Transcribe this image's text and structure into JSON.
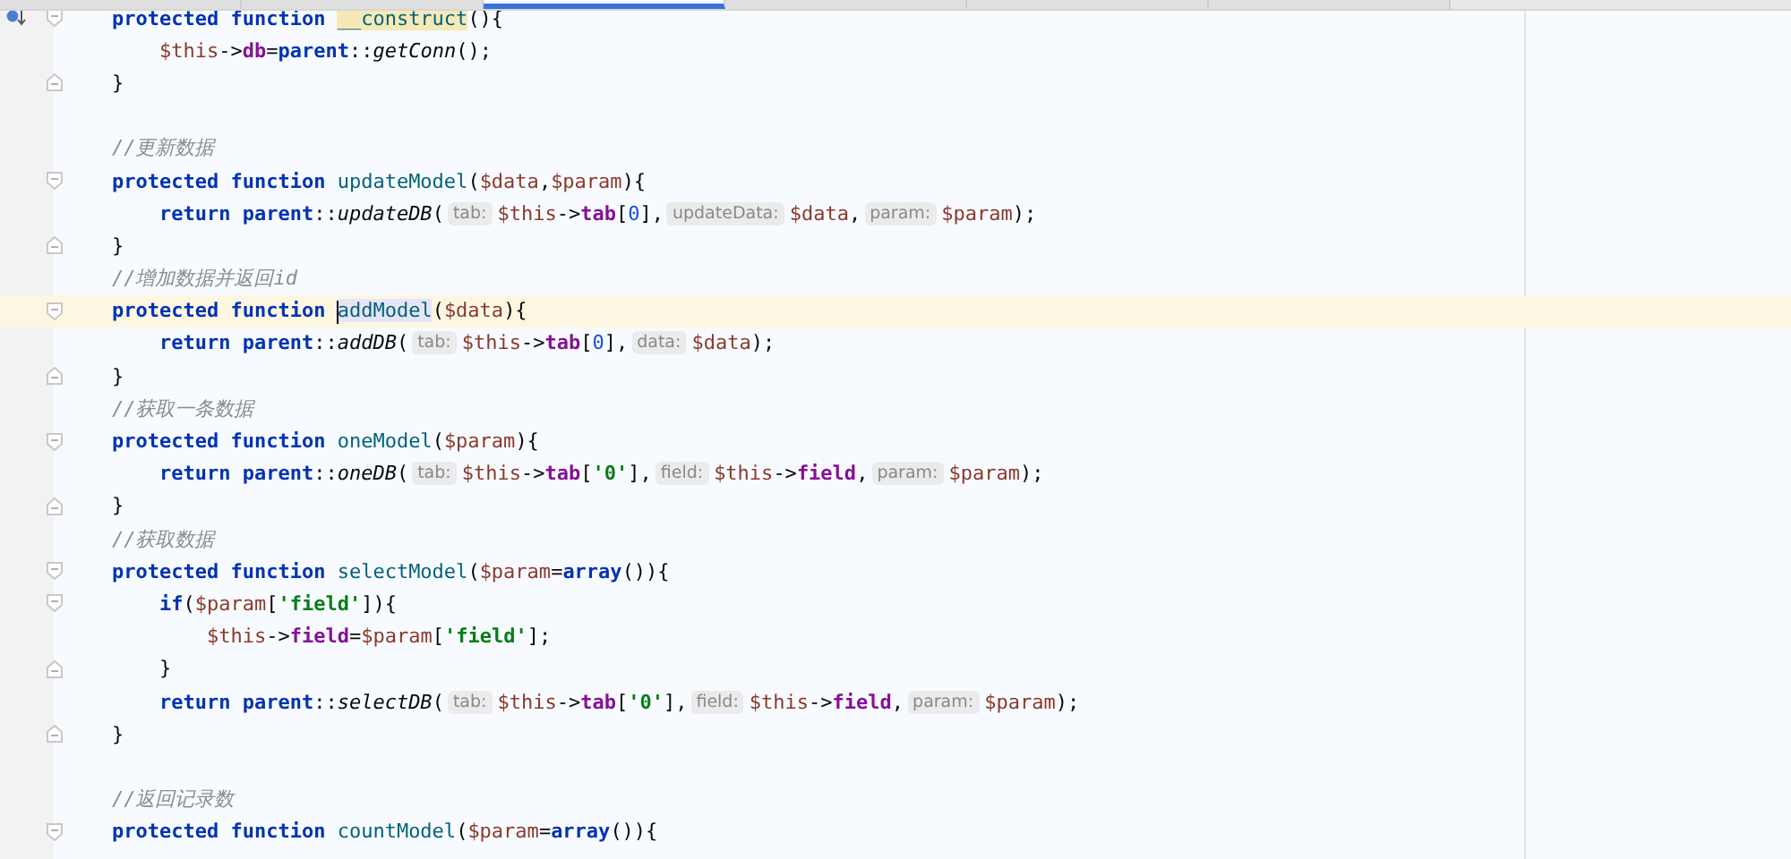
{
  "tabs": [
    {
      "selected": false
    },
    {
      "selected": false
    },
    {
      "selected": true
    },
    {
      "selected": false
    },
    {
      "selected": false
    },
    {
      "selected": false
    }
  ],
  "lines": [
    {
      "kind": "code",
      "fold_start": true,
      "gutter_mark": true,
      "segments": [
        {
          "kind": "code",
          "tokens": [
            {
              "kind": "kw",
              "s": "    protected function "
            },
            {
              "kind": "decl",
              "s": "__construct",
              "match_highlight": true
            },
            {
              "kind": "plain",
              "s": "(){"
            }
          ]
        }
      ]
    },
    {
      "kind": "code",
      "segments": [
        {
          "kind": "code",
          "tokens": [
            {
              "kind": "var",
              "s": "        $this"
            },
            {
              "kind": "plain",
              "s": "->"
            },
            {
              "kind": "prop",
              "s": "db"
            },
            {
              "kind": "plain",
              "s": "="
            },
            {
              "kind": "kw",
              "s": "parent"
            },
            {
              "kind": "plain",
              "s": "::"
            },
            {
              "kind": "call",
              "s": "getConn"
            },
            {
              "kind": "plain",
              "s": "();"
            }
          ]
        }
      ]
    },
    {
      "kind": "code",
      "fold_end": true,
      "segments": [
        {
          "kind": "code",
          "tokens": [
            {
              "kind": "plain",
              "s": "    }"
            }
          ]
        }
      ]
    },
    {
      "kind": "blank"
    },
    {
      "kind": "code",
      "segments": [
        {
          "kind": "code",
          "tokens": [
            {
              "kind": "comment",
              "s": "    //更新数据"
            }
          ]
        }
      ]
    },
    {
      "kind": "code",
      "fold_start": true,
      "segments": [
        {
          "kind": "code",
          "tokens": [
            {
              "kind": "kw",
              "s": "    protected function "
            },
            {
              "kind": "decl",
              "s": "updateModel"
            },
            {
              "kind": "plain",
              "s": "("
            },
            {
              "kind": "var",
              "s": "$data"
            },
            {
              "kind": "plain",
              "s": ","
            },
            {
              "kind": "var",
              "s": "$param"
            },
            {
              "kind": "plain",
              "s": "){"
            }
          ]
        }
      ]
    },
    {
      "kind": "code",
      "segments": [
        {
          "kind": "code",
          "tokens": [
            {
              "kind": "kw",
              "s": "        return parent"
            },
            {
              "kind": "plain",
              "s": "::"
            },
            {
              "kind": "call",
              "s": "updateDB"
            },
            {
              "kind": "plain",
              "s": "("
            }
          ]
        },
        {
          "kind": "hint",
          "text": "tab:"
        },
        {
          "kind": "code",
          "tokens": [
            {
              "kind": "var",
              "s": "$this"
            },
            {
              "kind": "plain",
              "s": "->"
            },
            {
              "kind": "prop",
              "s": "tab"
            },
            {
              "kind": "plain",
              "s": "["
            },
            {
              "kind": "num",
              "s": "0"
            },
            {
              "kind": "plain",
              "s": "],"
            }
          ]
        },
        {
          "kind": "hint",
          "text": "updateData:"
        },
        {
          "kind": "code",
          "tokens": [
            {
              "kind": "var",
              "s": "$data"
            },
            {
              "kind": "plain",
              "s": ","
            }
          ]
        },
        {
          "kind": "hint",
          "text": "param:"
        },
        {
          "kind": "code",
          "tokens": [
            {
              "kind": "var",
              "s": "$param"
            },
            {
              "kind": "plain",
              "s": ");"
            }
          ]
        }
      ]
    },
    {
      "kind": "code",
      "fold_end": true,
      "segments": [
        {
          "kind": "code",
          "tokens": [
            {
              "kind": "plain",
              "s": "    }"
            }
          ]
        }
      ]
    },
    {
      "kind": "code",
      "segments": [
        {
          "kind": "code",
          "tokens": [
            {
              "kind": "comment",
              "s": "    //增加数据并返回id"
            }
          ]
        }
      ]
    },
    {
      "kind": "code",
      "fold_start": true,
      "current": true,
      "segments": [
        {
          "kind": "code",
          "tokens": [
            {
              "kind": "kw",
              "s": "    protected function "
            },
            {
              "kind": "decl",
              "s": "addModel",
              "identifier_highlight": true,
              "caret": true
            },
            {
              "kind": "plain",
              "s": "("
            },
            {
              "kind": "var",
              "s": "$data"
            },
            {
              "kind": "plain",
              "s": "){"
            }
          ]
        }
      ]
    },
    {
      "kind": "code",
      "segments": [
        {
          "kind": "code",
          "tokens": [
            {
              "kind": "kw",
              "s": "        return parent"
            },
            {
              "kind": "plain",
              "s": "::"
            },
            {
              "kind": "call",
              "s": "addDB"
            },
            {
              "kind": "plain",
              "s": "("
            }
          ]
        },
        {
          "kind": "hint",
          "text": "tab:"
        },
        {
          "kind": "code",
          "tokens": [
            {
              "kind": "var",
              "s": "$this"
            },
            {
              "kind": "plain",
              "s": "->"
            },
            {
              "kind": "prop",
              "s": "tab"
            },
            {
              "kind": "plain",
              "s": "["
            },
            {
              "kind": "num",
              "s": "0"
            },
            {
              "kind": "plain",
              "s": "],"
            }
          ]
        },
        {
          "kind": "hint",
          "text": "data:"
        },
        {
          "kind": "code",
          "tokens": [
            {
              "kind": "var",
              "s": "$data"
            },
            {
              "kind": "plain",
              "s": ");"
            }
          ]
        }
      ]
    },
    {
      "kind": "code",
      "fold_end": true,
      "segments": [
        {
          "kind": "code",
          "tokens": [
            {
              "kind": "plain",
              "s": "    }"
            }
          ]
        }
      ]
    },
    {
      "kind": "code",
      "segments": [
        {
          "kind": "code",
          "tokens": [
            {
              "kind": "comment",
              "s": "    //获取一条数据"
            }
          ]
        }
      ]
    },
    {
      "kind": "code",
      "fold_start": true,
      "segments": [
        {
          "kind": "code",
          "tokens": [
            {
              "kind": "kw",
              "s": "    protected function "
            },
            {
              "kind": "decl",
              "s": "oneModel"
            },
            {
              "kind": "plain",
              "s": "("
            },
            {
              "kind": "var",
              "s": "$param"
            },
            {
              "kind": "plain",
              "s": "){"
            }
          ]
        }
      ]
    },
    {
      "kind": "code",
      "segments": [
        {
          "kind": "code",
          "tokens": [
            {
              "kind": "kw",
              "s": "        return parent"
            },
            {
              "kind": "plain",
              "s": "::"
            },
            {
              "kind": "call",
              "s": "oneDB"
            },
            {
              "kind": "plain",
              "s": "("
            }
          ]
        },
        {
          "kind": "hint",
          "text": "tab:"
        },
        {
          "kind": "code",
          "tokens": [
            {
              "kind": "var",
              "s": "$this"
            },
            {
              "kind": "plain",
              "s": "->"
            },
            {
              "kind": "prop",
              "s": "tab"
            },
            {
              "kind": "plain",
              "s": "["
            },
            {
              "kind": "str",
              "s": "'0'"
            },
            {
              "kind": "plain",
              "s": "],"
            }
          ]
        },
        {
          "kind": "hint",
          "text": "field:"
        },
        {
          "kind": "code",
          "tokens": [
            {
              "kind": "var",
              "s": "$this"
            },
            {
              "kind": "plain",
              "s": "->"
            },
            {
              "kind": "prop",
              "s": "field"
            },
            {
              "kind": "plain",
              "s": ","
            }
          ]
        },
        {
          "kind": "hint",
          "text": "param:"
        },
        {
          "kind": "code",
          "tokens": [
            {
              "kind": "var",
              "s": "$param"
            },
            {
              "kind": "plain",
              "s": ");"
            }
          ]
        }
      ]
    },
    {
      "kind": "code",
      "fold_end": true,
      "segments": [
        {
          "kind": "code",
          "tokens": [
            {
              "kind": "plain",
              "s": "    }"
            }
          ]
        }
      ]
    },
    {
      "kind": "code",
      "segments": [
        {
          "kind": "code",
          "tokens": [
            {
              "kind": "comment",
              "s": "    //获取数据"
            }
          ]
        }
      ]
    },
    {
      "kind": "code",
      "fold_start": true,
      "segments": [
        {
          "kind": "code",
          "tokens": [
            {
              "kind": "kw",
              "s": "    protected function "
            },
            {
              "kind": "decl",
              "s": "selectModel"
            },
            {
              "kind": "plain",
              "s": "("
            },
            {
              "kind": "var",
              "s": "$param"
            },
            {
              "kind": "plain",
              "s": "="
            },
            {
              "kind": "kw",
              "s": "array"
            },
            {
              "kind": "plain",
              "s": "()){"
            }
          ]
        }
      ]
    },
    {
      "kind": "code",
      "fold_start": true,
      "segments": [
        {
          "kind": "code",
          "tokens": [
            {
              "kind": "kw",
              "s": "        if"
            },
            {
              "kind": "plain",
              "s": "("
            },
            {
              "kind": "var",
              "s": "$param"
            },
            {
              "kind": "plain",
              "s": "["
            },
            {
              "kind": "str",
              "s": "'field'"
            },
            {
              "kind": "plain",
              "s": "]){"
            }
          ]
        }
      ]
    },
    {
      "kind": "code",
      "segments": [
        {
          "kind": "code",
          "tokens": [
            {
              "kind": "var",
              "s": "            $this"
            },
            {
              "kind": "plain",
              "s": "->"
            },
            {
              "kind": "prop",
              "s": "field"
            },
            {
              "kind": "plain",
              "s": "="
            },
            {
              "kind": "var",
              "s": "$param"
            },
            {
              "kind": "plain",
              "s": "["
            },
            {
              "kind": "str",
              "s": "'field'"
            },
            {
              "kind": "plain",
              "s": "];"
            }
          ]
        }
      ]
    },
    {
      "kind": "code",
      "fold_end": true,
      "segments": [
        {
          "kind": "code",
          "tokens": [
            {
              "kind": "plain",
              "s": "        }"
            }
          ]
        }
      ]
    },
    {
      "kind": "code",
      "segments": [
        {
          "kind": "code",
          "tokens": [
            {
              "kind": "kw",
              "s": "        return parent"
            },
            {
              "kind": "plain",
              "s": "::"
            },
            {
              "kind": "call",
              "s": "selectDB"
            },
            {
              "kind": "plain",
              "s": "("
            }
          ]
        },
        {
          "kind": "hint",
          "text": "tab:"
        },
        {
          "kind": "code",
          "tokens": [
            {
              "kind": "var",
              "s": "$this"
            },
            {
              "kind": "plain",
              "s": "->"
            },
            {
              "kind": "prop",
              "s": "tab"
            },
            {
              "kind": "plain",
              "s": "["
            },
            {
              "kind": "str",
              "s": "'0'"
            },
            {
              "kind": "plain",
              "s": "],"
            }
          ]
        },
        {
          "kind": "hint",
          "text": "field:"
        },
        {
          "kind": "code",
          "tokens": [
            {
              "kind": "var",
              "s": "$this"
            },
            {
              "kind": "plain",
              "s": "->"
            },
            {
              "kind": "prop",
              "s": "field"
            },
            {
              "kind": "plain",
              "s": ","
            }
          ]
        },
        {
          "kind": "hint",
          "text": "param:"
        },
        {
          "kind": "code",
          "tokens": [
            {
              "kind": "var",
              "s": "$param"
            },
            {
              "kind": "plain",
              "s": ");"
            }
          ]
        }
      ]
    },
    {
      "kind": "code",
      "fold_end": true,
      "segments": [
        {
          "kind": "code",
          "tokens": [
            {
              "kind": "plain",
              "s": "    }"
            }
          ]
        }
      ]
    },
    {
      "kind": "blank"
    },
    {
      "kind": "code",
      "segments": [
        {
          "kind": "code",
          "tokens": [
            {
              "kind": "comment",
              "s": "    //返回记录数"
            }
          ]
        }
      ]
    },
    {
      "kind": "code",
      "fold_start": true,
      "segments": [
        {
          "kind": "code",
          "tokens": [
            {
              "kind": "kw",
              "s": "    protected function "
            },
            {
              "kind": "decl",
              "s": "countModel"
            },
            {
              "kind": "plain",
              "s": "("
            },
            {
              "kind": "var",
              "s": "$param"
            },
            {
              "kind": "plain",
              "s": "="
            },
            {
              "kind": "kw",
              "s": "array"
            },
            {
              "kind": "plain",
              "s": "()){"
            }
          ]
        }
      ]
    }
  ]
}
